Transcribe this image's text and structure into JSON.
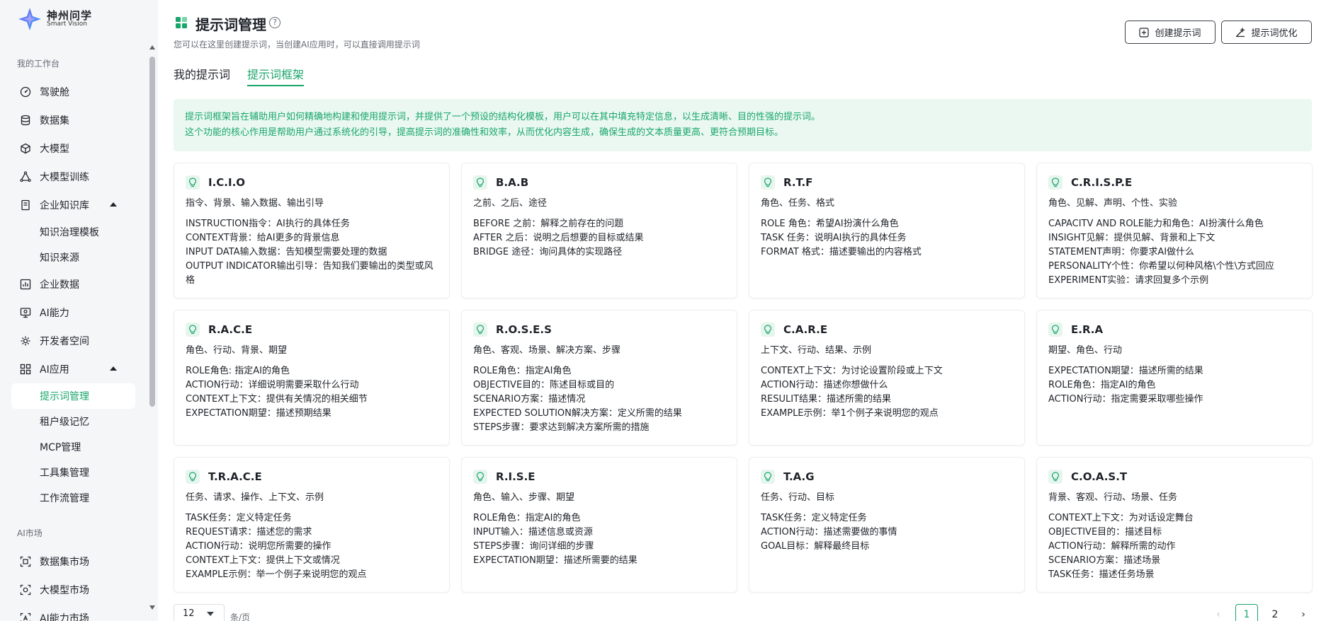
{
  "brand": {
    "name_cn": "神州问学",
    "name_en": "Smart Vision"
  },
  "sidebar": {
    "sections": [
      {
        "label": "我的工作台",
        "items": [
          {
            "label": "驾驶舱",
            "icon": "dashboard-icon"
          },
          {
            "label": "数据集",
            "icon": "database-icon"
          },
          {
            "label": "大模型",
            "icon": "cube-icon"
          },
          {
            "label": "大模型训练",
            "icon": "training-icon"
          },
          {
            "label": "企业知识库",
            "icon": "knowledge-icon",
            "expanded": true,
            "children": [
              "知识治理模板",
              "知识来源"
            ]
          },
          {
            "label": "企业数据",
            "icon": "chart-icon"
          },
          {
            "label": "AI能力",
            "icon": "ai-ability-icon"
          },
          {
            "label": "开发者空间",
            "icon": "developer-icon"
          },
          {
            "label": "AI应用",
            "icon": "apps-icon",
            "expanded": true,
            "children": [
              "提示词管理",
              "租户级记忆",
              "MCP管理",
              "工具集管理",
              "工作流管理"
            ],
            "active_child": "提示词管理"
          }
        ]
      },
      {
        "label": "AI市场",
        "items": [
          {
            "label": "数据集市场",
            "icon": "dataset-market-icon"
          },
          {
            "label": "大模型市场",
            "icon": "model-market-icon"
          },
          {
            "label": "AI能力市场",
            "icon": "ai-market-icon"
          }
        ]
      }
    ]
  },
  "header": {
    "title": "提示词管理",
    "subtitle": "您可以在这里创建提示词，当创建AI应用时，可以直接调用提示词",
    "create_button": "创建提示词",
    "optimize_button": "提示词优化"
  },
  "tabs": [
    {
      "label": "我的提示词",
      "active": false
    },
    {
      "label": "提示词框架",
      "active": true
    }
  ],
  "info": {
    "line1": "提示词框架旨在辅助用户如何精确地构建和使用提示词，并提供了一个预设的结构化模板，用户可以在其中填充特定信息，以生成清晰、目的性强的提示词。",
    "line2": "这个功能的核心作用是帮助用户通过系统化的引导，提高提示词的准确性和效率，从而优化内容生成，确保生成的文本质量更高、更符合预期目标。"
  },
  "cards": [
    {
      "title": "I.C.I.O",
      "tags": "指令、背景、输入数据、输出引导",
      "lines": [
        "INSTRUCTION指令：AI执行的具体任务",
        "CONTEXT背景：给AI更多的背景信息",
        "INPUT DATA输入数据：告知模型需要处理的数据",
        "OUTPUT INDICATOR输出引导：告知我们要输出的类型或风格"
      ]
    },
    {
      "title": "B.A.B",
      "tags": "之前、之后、途径",
      "lines": [
        "BEFORE 之前：解释之前存在的问题",
        "AFTER 之后：说明之后想要的目标或结果",
        "BRIDGE 途径：询问具体的实现路径"
      ]
    },
    {
      "title": "R.T.F",
      "tags": "角色、任务、格式",
      "lines": [
        "ROLE 角色：希望AI扮演什么角色",
        "TASK 任务：说明AI执行的具体任务",
        "FORMAT 格式：描述要输出的内容格式"
      ]
    },
    {
      "title": "C.R.I.S.P.E",
      "tags": "角色、见解、声明、个性、实验",
      "lines": [
        "CAPACITV AND ROLE能力和角色：AI扮演什么角色",
        "INSIGHT见解：提供见解、背景和上下文",
        "STATEMENT声明：你要求AI做什么",
        "PERSONALITY个性：你希望以何种风格\\个性\\方式回应",
        "EXPERIMENT实验：请求回复多个示例"
      ]
    },
    {
      "title": "R.A.C.E",
      "tags": "角色、行动、背景、期望",
      "lines": [
        "ROLE角色: 指定AI的角色",
        "ACTION行动：详细说明需要采取什么行动",
        "CONTEXT上下文：提供有关情况的相关细节",
        "EXPECTATION期望：描述预期结果"
      ]
    },
    {
      "title": "R.O.S.E.S",
      "tags": "角色、客观、场景、解决方案、步骤",
      "lines": [
        "ROLE角色：指定AI角色",
        "OBJECTIVE目的：陈述目标或目的",
        "SCENARIO方案：描述情况",
        "EXPECTED SOLUTION解决方案：定义所需的结果",
        "STEPS步骤：要求达到解决方案所需的措施"
      ]
    },
    {
      "title": "C.A.R.E",
      "tags": "上下文、行动、结果、示例",
      "lines": [
        "CONTEXT上下文：为讨论设置阶段或上下文",
        "ACTION行动：描述你想做什么",
        "RESULIT结果：描述所需的结果",
        "EXAMPLE示例：举1个例子来说明您的观点"
      ]
    },
    {
      "title": "E.R.A",
      "tags": "期望、角色、行动",
      "lines": [
        "EXPECTATION期望：描述所需的结果",
        "ROLE角色：指定AI的角色",
        "ACTION行动：指定需要采取哪些操作"
      ]
    },
    {
      "title": "T.R.A.C.E",
      "tags": "任务、请求、操作、上下文、示例",
      "lines": [
        "TASK任务：定义特定任务",
        "REQUEST请求：描述您的需求",
        "ACTION行动：说明您所需要的操作",
        "CONTEXT上下文：提供上下文或情况",
        "EXAMPLE示例：举一个例子来说明您的观点"
      ]
    },
    {
      "title": "R.I.S.E",
      "tags": "角色、输入、步骤、期望",
      "lines": [
        "ROLE角色：指定AI的角色",
        "INPUT输入：描述信息或资源",
        "STEPS步骤：询问详细的步骤",
        "EXPECTATION期望：描述所需要的结果"
      ]
    },
    {
      "title": "T.A.G",
      "tags": "任务、行动、目标",
      "lines": [
        "TASK任务：定义特定任务",
        "ACTION行动：描述需要做的事情",
        "GOAL目标：解释最终目标"
      ]
    },
    {
      "title": "C.O.A.S.T",
      "tags": "背景、客观、行动、场景、任务",
      "lines": [
        "CONTEXT上下文：为对话设定舞台",
        "OBJECTIVE目的：描述目标",
        "ACTION行动：解释所需的动作",
        "SCENARIO方案：描述场景",
        "TASK任务：描述任务场景"
      ]
    }
  ],
  "pagination": {
    "page_size": "12",
    "unit": "条/页",
    "prev": "‹",
    "next": "›",
    "pages": [
      "1",
      "2"
    ],
    "current": "1"
  },
  "colors": {
    "accent": "#1aa66b",
    "info_bg": "#eaf8f1",
    "sidebar_bg": "#f5f6f8"
  }
}
